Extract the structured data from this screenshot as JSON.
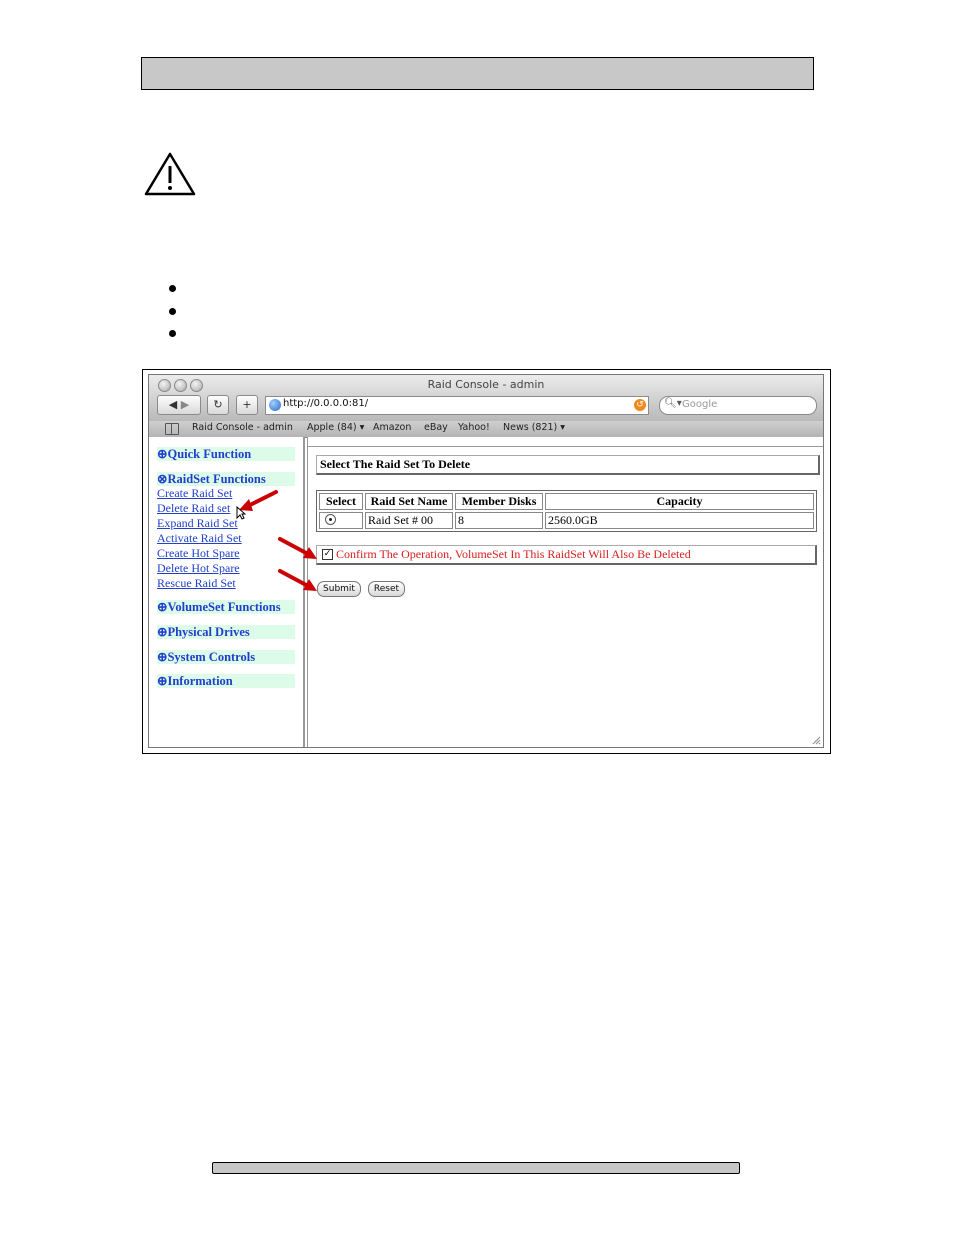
{
  "browser": {
    "window_title": "Raid Console - admin",
    "url": "http://0.0.0.0:81/",
    "search_placeholder": "Google",
    "bookmarks": [
      "Raid Console - admin",
      "Apple (84) ▾",
      "Amazon",
      "eBay",
      "Yahoo!",
      "News (821) ▾"
    ]
  },
  "sidebar": {
    "quick_function": "⊕Quick Function",
    "raidset_functions": "⊗RaidSet Functions",
    "raidset_links": [
      "Create Raid Set",
      "Delete Raid set",
      "Expand Raid Set",
      "Activate Raid Set",
      "Create Hot Spare",
      "Delete Hot Spare",
      "Rescue Raid Set"
    ],
    "volumeset_functions": "⊕VolumeSet Functions",
    "physical_drives": "⊕Physical Drives",
    "system_controls": "⊕System Controls",
    "information": "⊕Information"
  },
  "content": {
    "panel_title": "Select The Raid Set To Delete",
    "table": {
      "headers": [
        "Select",
        "Raid Set Name",
        "Member Disks",
        "Capacity"
      ],
      "rows": [
        {
          "name": "Raid Set # 00",
          "disks": "8",
          "capacity": "2560.0GB"
        }
      ]
    },
    "confirm_label": "Confirm The Operation, VolumeSet In This RaidSet Will Also Be Deleted",
    "confirm_checked": true,
    "submit_label": "Submit",
    "reset_label": "Reset"
  },
  "colors": {
    "link_blue": "#1f3fcc",
    "menu_highlight": "#dcfbe8",
    "confirm_red": "#d61e1e",
    "annotation_arrow": "#cc0000"
  }
}
